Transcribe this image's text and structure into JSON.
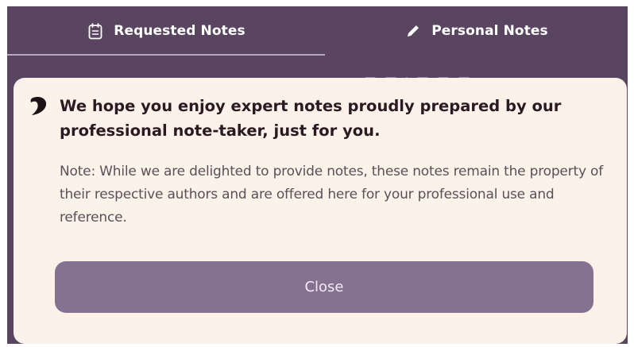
{
  "tabs": {
    "requested": {
      "label": "Requested Notes",
      "icon": "notepad-icon",
      "active": true
    },
    "personal": {
      "label": "Personal Notes",
      "icon": "pencil-icon",
      "active": false
    }
  },
  "modal": {
    "logo_icon": "brand-logo-icon",
    "title": "We hope you enjoy expert notes proudly prepared by our professional note-taker, just for you.",
    "body": "Note: While we are delighted to provide notes, these notes remain the property of their respective authors and are offered here for your professional use and reference.",
    "close_label": "Close"
  },
  "colors": {
    "background": "#5a4560",
    "modal_background": "#fdf2ea",
    "button": "#857190",
    "title_text": "#2b1a22",
    "body_text": "#5a5056"
  }
}
